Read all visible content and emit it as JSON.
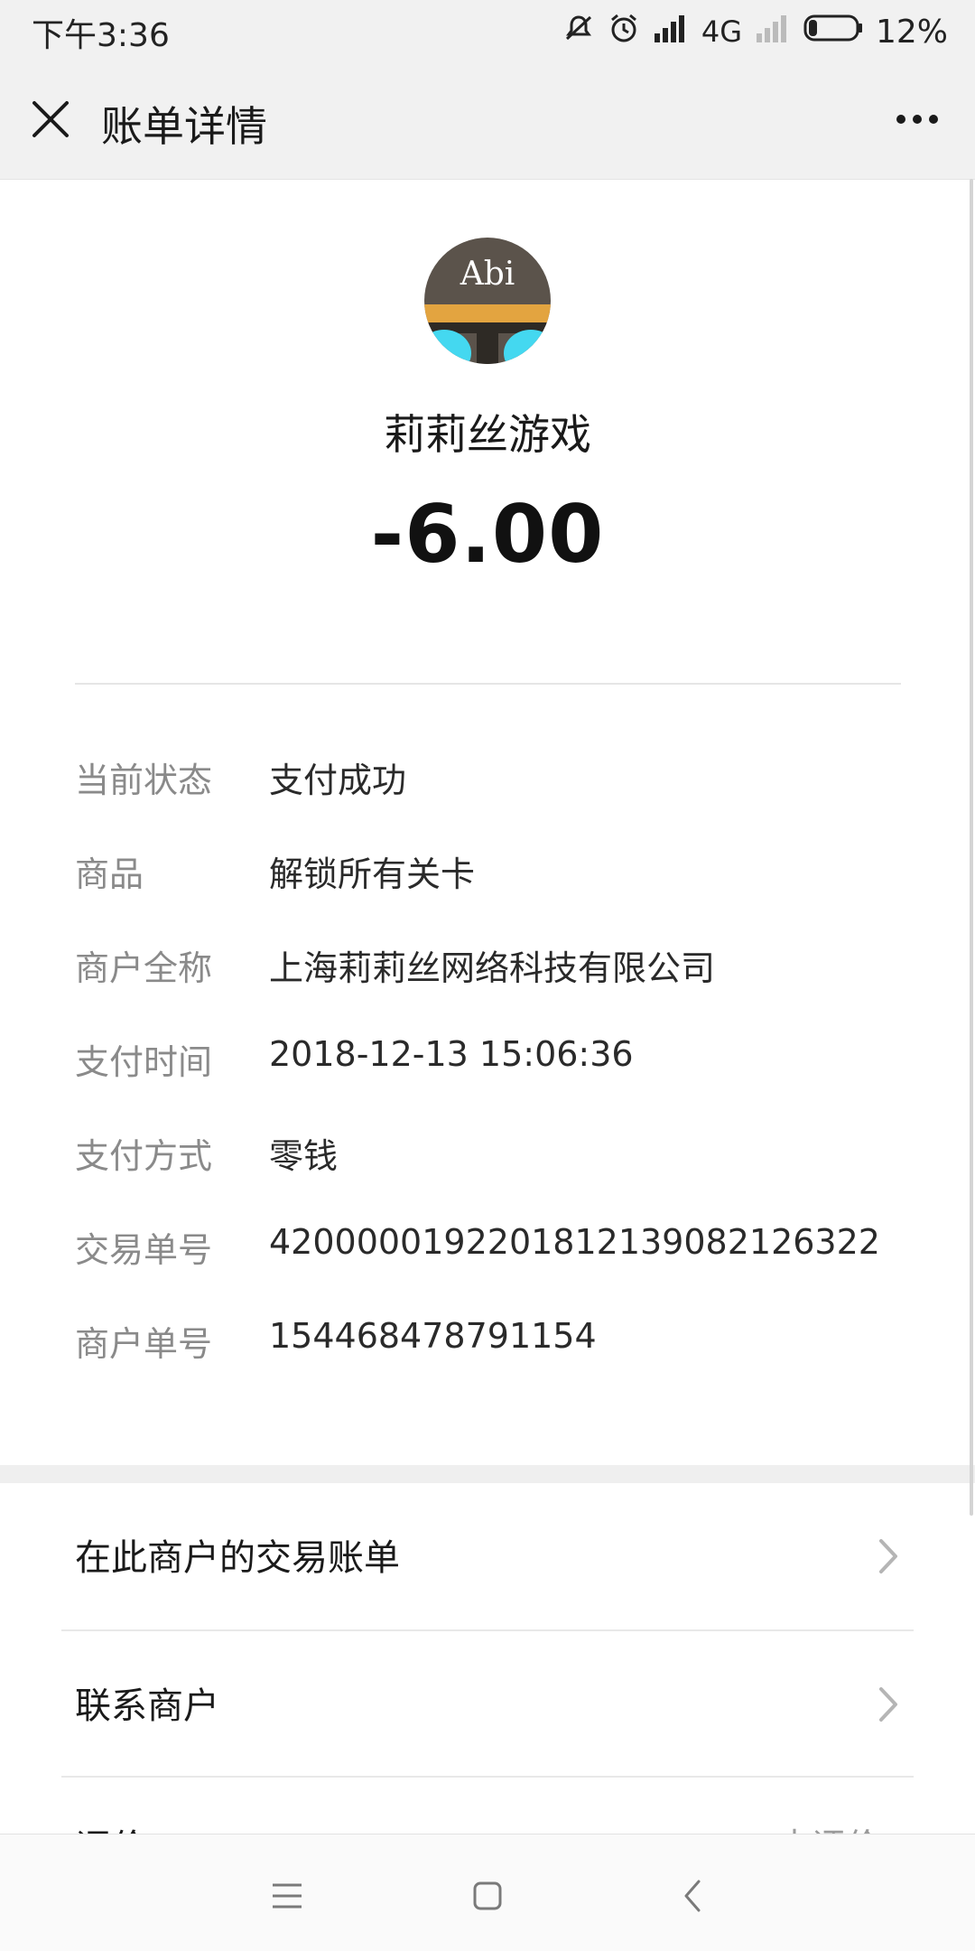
{
  "status_bar": {
    "time": "下午3:36",
    "network": "4G",
    "battery": "12%"
  },
  "header": {
    "title": "账单详情"
  },
  "merchant": {
    "avatar_text": "Abi",
    "name": "莉莉丝游戏",
    "amount": "-6.00"
  },
  "details": [
    {
      "label": "当前状态",
      "value": "支付成功"
    },
    {
      "label": "商品",
      "value": "解锁所有关卡"
    },
    {
      "label": "商户全称",
      "value": "上海莉莉丝网络科技有限公司"
    },
    {
      "label": "支付时间",
      "value": "2018-12-13 15:06:36"
    },
    {
      "label": "支付方式",
      "value": "零钱"
    },
    {
      "label": "交易单号",
      "value": "4200000192201812139082126322"
    },
    {
      "label": "商户单号",
      "value": "154468478791154"
    }
  ],
  "links": {
    "merchant_bills": "在此商户的交易账单",
    "contact_merchant": "联系商户",
    "evaluate_label": "评价",
    "evaluate_status": "去评价"
  },
  "icons": {
    "close": "close-icon",
    "more": "more-icon",
    "chevron": "chevron-right-icon",
    "menu": "menu-icon",
    "home": "home-icon",
    "back": "back-icon"
  },
  "colors": {
    "header_bg": "#f1f1f1",
    "label": "#8a8a8a",
    "value": "#2a2a2a",
    "avatar_gold": "#e3a440",
    "avatar_cyan": "#44d8f0"
  }
}
